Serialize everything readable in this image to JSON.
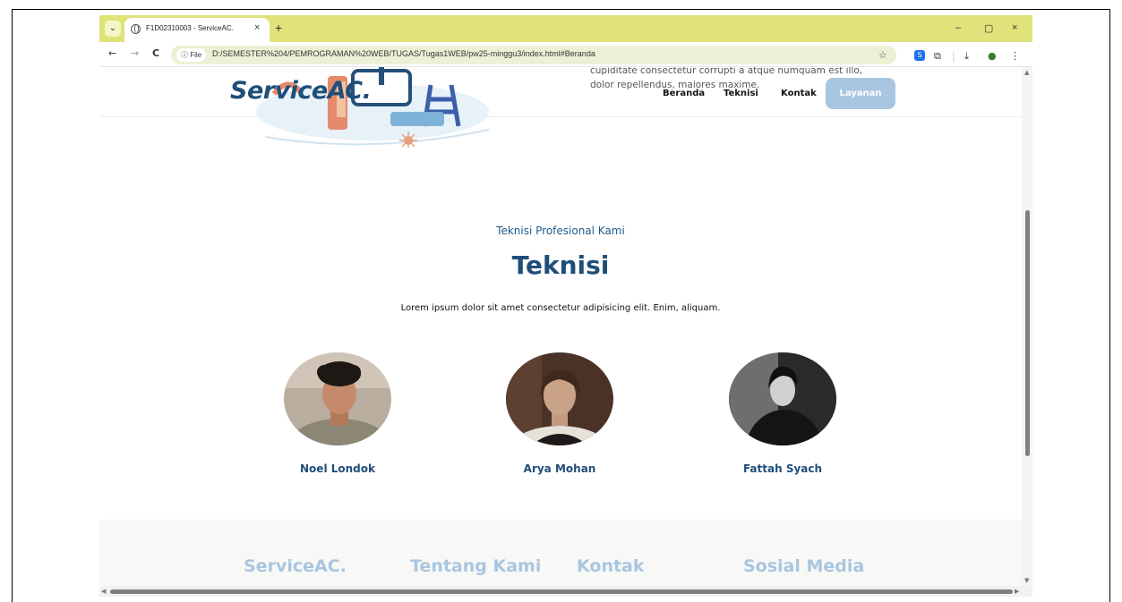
{
  "browser": {
    "tab_title": "F1D02310003 - ServiceAC.",
    "tab_close": "×",
    "new_tab": "+",
    "window_controls": {
      "minimize": "–",
      "maximize": "▢",
      "close": "×"
    },
    "nav": {
      "back": "←",
      "forward": "→",
      "reload": "C"
    },
    "file_chip": "ⓘ File",
    "url": "D:/SEMESTER%204/PEMROGRAMAN%20WEB/TUGAS/Tugas1WEB/pw25-minggu3/index.html#Beranda",
    "bookmark": "☆",
    "extensions": [
      "S",
      "puzzle-icon",
      "download-icon",
      "profile-icon",
      "menu-icon"
    ]
  },
  "navbar": {
    "logo": "ServiceAC.",
    "hero_text_line1": "cupiditate consectetur corrupti a atque numquam est illo,",
    "hero_text_line2": "dolor repellendus, maiores maxime.",
    "links": [
      "Beranda",
      "Teknisi",
      "Kontak"
    ],
    "cta": "Layanan"
  },
  "team": {
    "subtitle": "Teknisi Profesional Kami",
    "title": "Teknisi",
    "description": "Lorem ipsum dolor sit amet consectetur adipisicing elit. Enim, aliquam.",
    "members": [
      {
        "name": "Noel Londok"
      },
      {
        "name": "Arya Mohan"
      },
      {
        "name": "Fattah Syach"
      }
    ]
  },
  "footer": {
    "headings": [
      "ServiceAC.",
      "Tentang Kami",
      "Kontak",
      "Sosial Media"
    ]
  },
  "colors": {
    "tabbar": "#dfe37a",
    "brand_dark": "#1f4e79",
    "brand_light": "#a9c6e0"
  }
}
